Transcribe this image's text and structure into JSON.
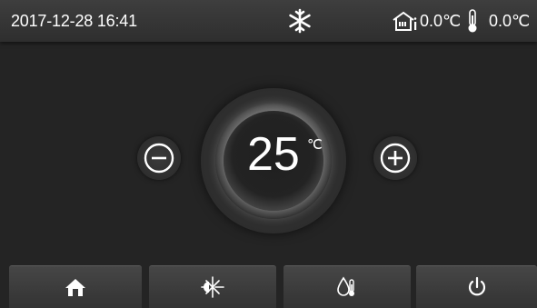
{
  "status_bar": {
    "date": "2017-12-28",
    "time": "16:41",
    "datetime": "2017-12-28  16:41",
    "mode_icon": "snowflake-icon",
    "outdoor_temp_icon": "house-sensor-icon",
    "outdoor_temp": "0.0℃",
    "water_temp_icon": "thermometer-icon",
    "water_temp": "0.0℃"
  },
  "setpoint": {
    "value": "25",
    "unit": "℃",
    "decrease_icon": "minus-icon",
    "increase_icon": "plus-icon"
  },
  "bottom_nav": [
    {
      "icon": "home-icon"
    },
    {
      "icon": "mode-cool-heat-icon"
    },
    {
      "icon": "water-thermometer-icon"
    },
    {
      "icon": "power-icon"
    }
  ],
  "colors": {
    "background": "#242424",
    "bar": "#3a3a3a",
    "text": "#ffffff"
  }
}
